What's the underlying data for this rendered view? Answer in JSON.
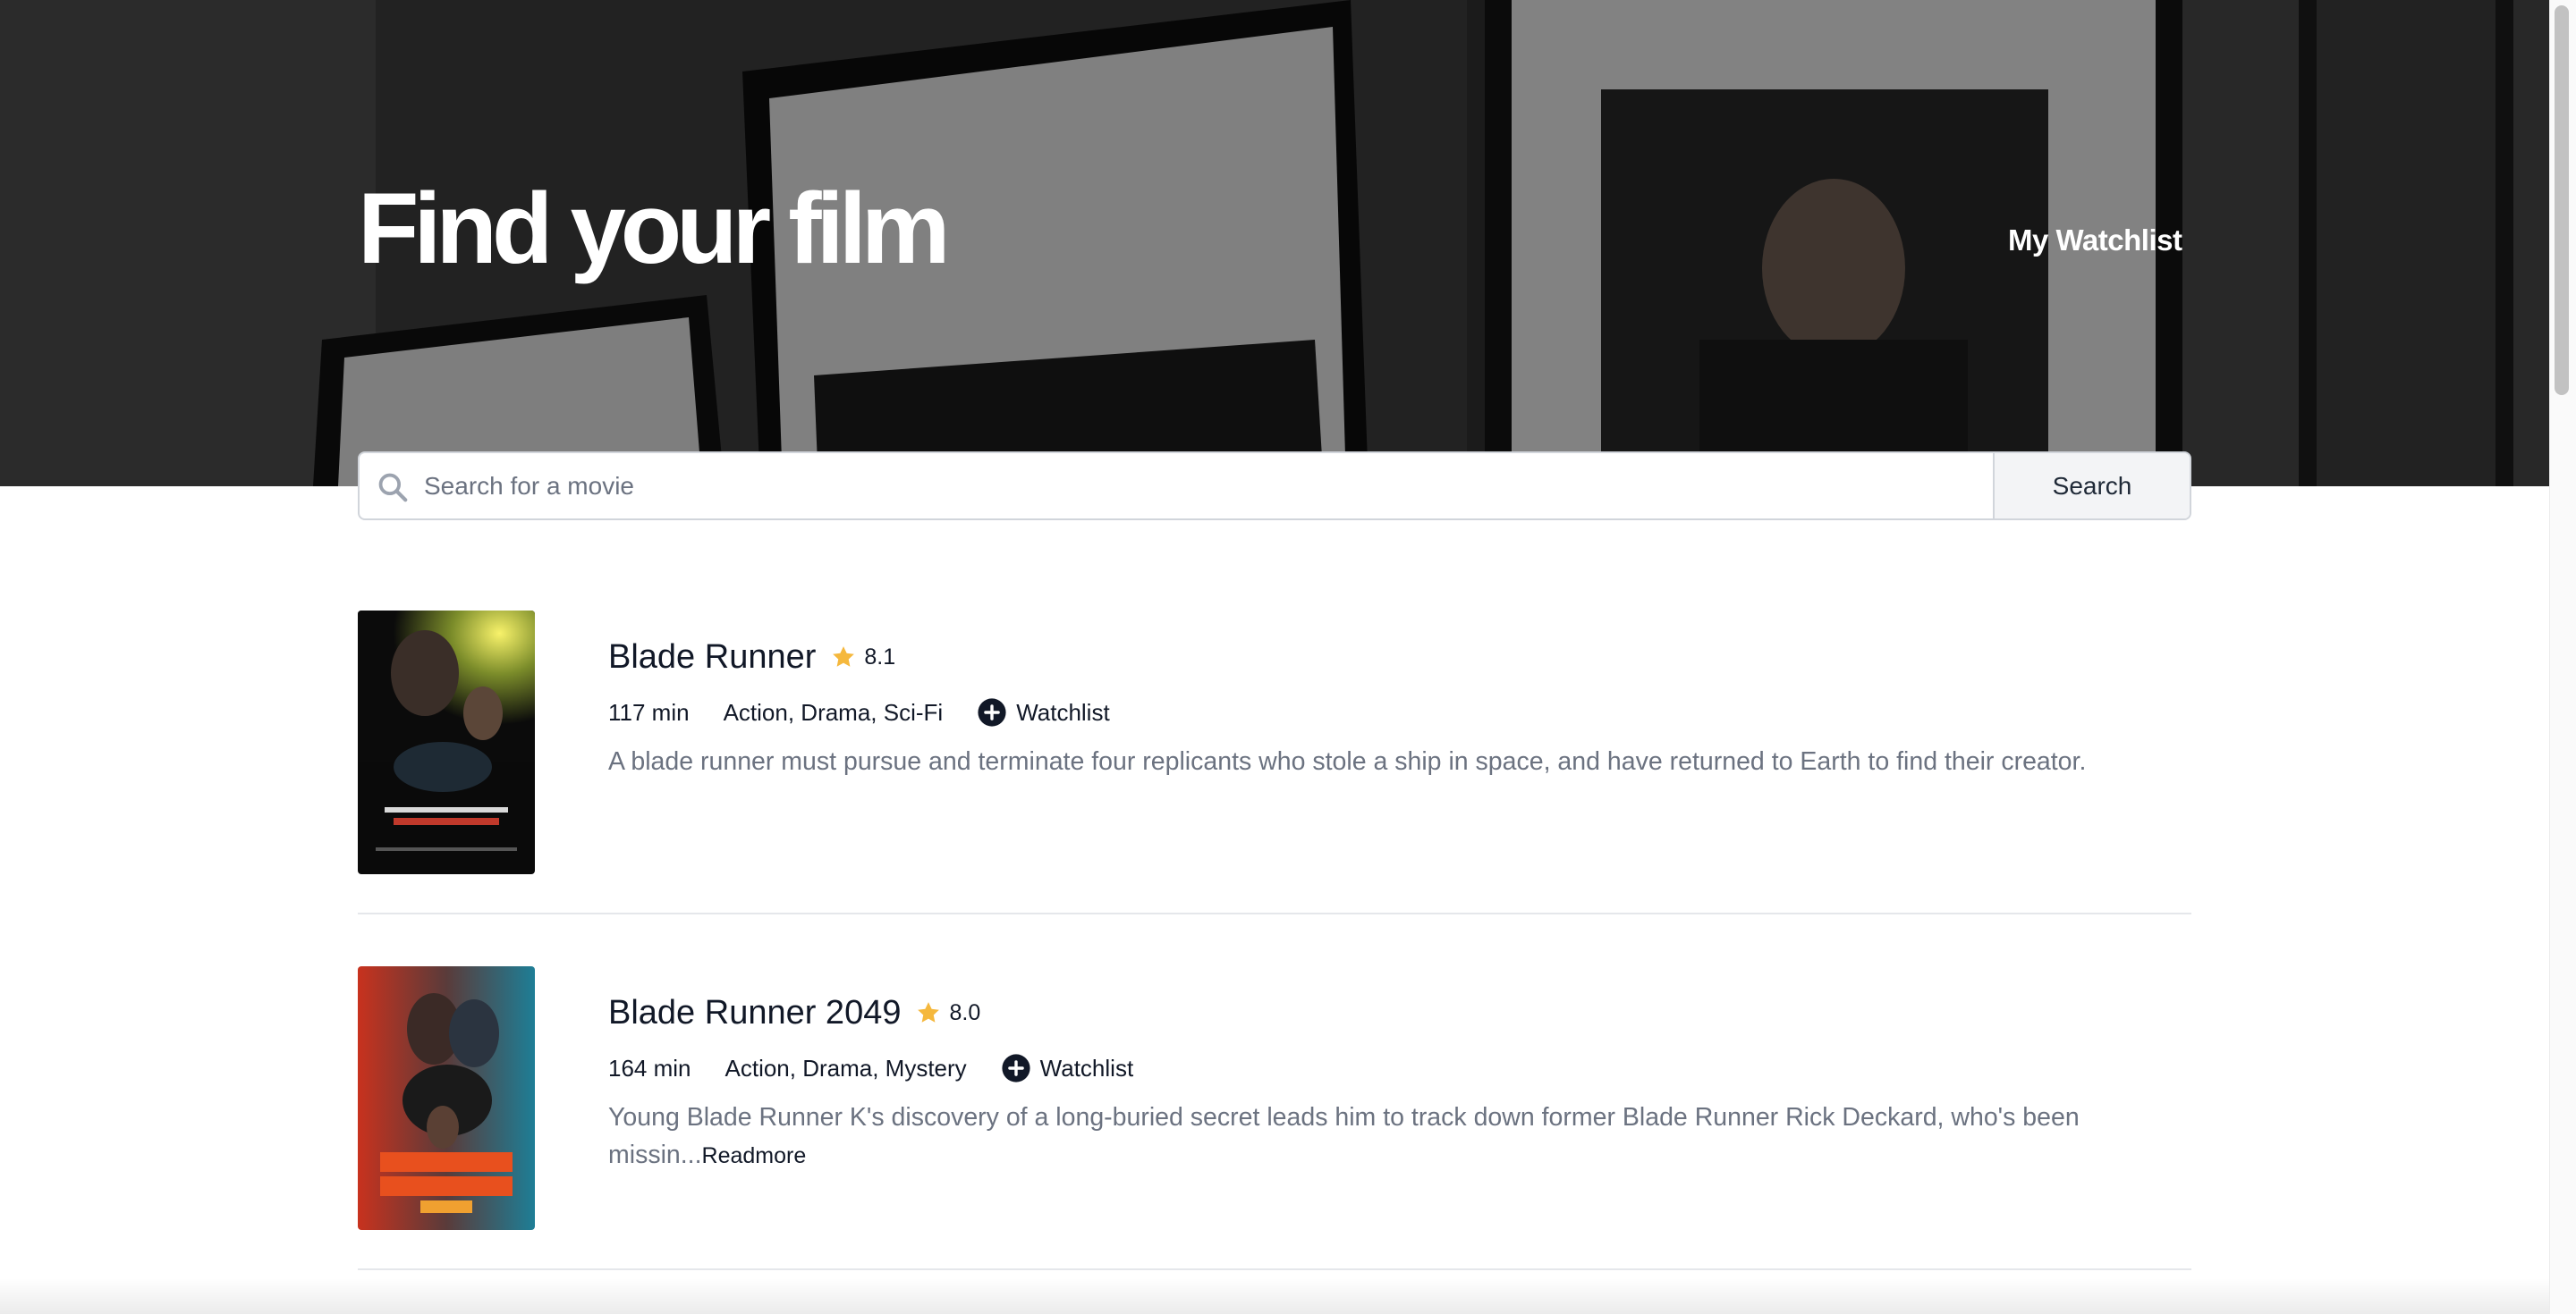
{
  "hero": {
    "title": "Find your film",
    "nav_watchlist": "My Watchlist"
  },
  "search": {
    "placeholder": "Search for a movie",
    "value": "",
    "button_label": "Search"
  },
  "movies": [
    {
      "title": "Blade Runner",
      "rating": "8.1",
      "runtime": "117 min",
      "genres": "Action, Drama, Sci-Fi",
      "watchlist_label": "Watchlist",
      "plot": "A blade runner must pursue and terminate four replicants who stole a ship in space, and have returned to Earth to find their creator.",
      "readmore": ""
    },
    {
      "title": "Blade Runner 2049",
      "rating": "8.0",
      "runtime": "164 min",
      "genres": "Action, Drama, Mystery",
      "watchlist_label": "Watchlist",
      "plot": "Young Blade Runner K's discovery of a long-buried secret leads him to track down former Blade Runner Rick Deckard, who's been missin...",
      "readmore": "Readmore"
    }
  ],
  "colors": {
    "star": "#f5b83d",
    "muted_text": "#6b7280",
    "divider": "#e5e7eb"
  },
  "icons": {
    "search": "search-icon",
    "star": "star-icon",
    "add": "plus-circle-icon"
  }
}
